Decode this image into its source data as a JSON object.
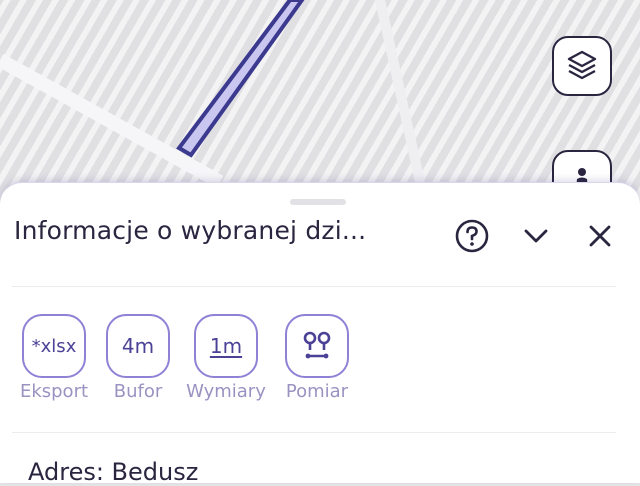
{
  "map": {
    "layers_button_icon": "layers-icon",
    "streetview_button_icon": "person-icon"
  },
  "panel": {
    "title": "Informacje o wybranej dzi...",
    "help_icon": "help-circle-icon",
    "collapse_icon": "chevron-down-icon",
    "close_icon": "close-icon"
  },
  "tools": [
    {
      "id": "export",
      "icon_text": "*xlsx",
      "label": "Eksport"
    },
    {
      "id": "buffer",
      "icon_text": "4m",
      "label": "Bufor"
    },
    {
      "id": "dimensions",
      "icon_text": "1m",
      "label": "Wymiary"
    },
    {
      "id": "measure",
      "icon_text": "",
      "label": "Pomiar"
    }
  ],
  "address": "Adres: Bedusz",
  "colors": {
    "accent": "#8d82d6",
    "text_dark": "#2b2540",
    "label_muted": "#9a93c2",
    "parcel_line": "#3b3a8f"
  }
}
